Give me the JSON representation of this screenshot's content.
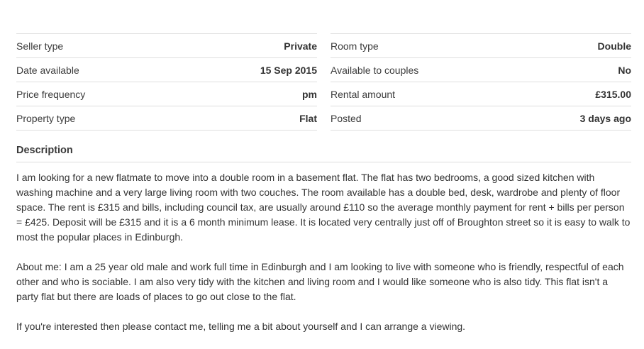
{
  "attributes_left": [
    {
      "label": "Seller type",
      "value": "Private"
    },
    {
      "label": "Date available",
      "value": "15 Sep 2015"
    },
    {
      "label": "Price frequency",
      "value": "pm"
    },
    {
      "label": "Property type",
      "value": "Flat"
    }
  ],
  "attributes_right": [
    {
      "label": "Room type",
      "value": "Double"
    },
    {
      "label": "Available to couples",
      "value": "No"
    },
    {
      "label": "Rental amount",
      "value": "£315.00"
    },
    {
      "label": "Posted",
      "value": "3 days ago"
    }
  ],
  "description": {
    "heading": "Description",
    "paragraphs": [
      "I am looking for a new flatmate to move into a double room in a basement flat. The flat has two bedrooms, a good sized kitchen with washing machine and a very large living room with two couches. The room available has a double bed, desk, wardrobe and plenty of floor space. The rent is £315 and bills, including council tax, are usually around £110 so the average monthly payment for rent + bills per person = £425. Deposit will be £315 and it is a 6 month minimum lease. It is located very centrally just off of Broughton street so it is easy to walk to most the popular places in Edinburgh.",
      "About me: I am a 25 year old male and work full time in Edinburgh and I am looking to live with someone who is friendly, respectful of each other and who is sociable. I am also very tidy with the kitchen and living room and I would like someone who is also tidy. This flat isn't a party flat but there are loads of places to go out close to the flat.",
      "If you're interested then please contact me, telling me a bit about yourself and I can arrange a viewing."
    ]
  }
}
